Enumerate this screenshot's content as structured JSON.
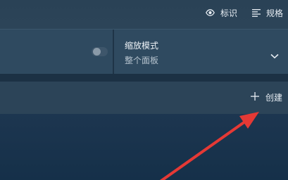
{
  "toolbar": {
    "ident_label": "标识",
    "ident_icon": "eye-icon",
    "spec_label": "规格",
    "spec_icon": "list-icon"
  },
  "settings": {
    "toggle_state": "off",
    "zoom_mode": {
      "title": "缩放模式",
      "value": "整个面板",
      "icon": "chevron-down-icon"
    }
  },
  "actions": {
    "create_label": "创建",
    "create_icon": "plus-icon"
  },
  "annotation": {
    "type": "arrow",
    "color": "#e53935"
  },
  "colors": {
    "background": "#1d3650",
    "panel": "#2f4a60",
    "text": "#e8eef4",
    "subtext": "#b7c4cf"
  }
}
